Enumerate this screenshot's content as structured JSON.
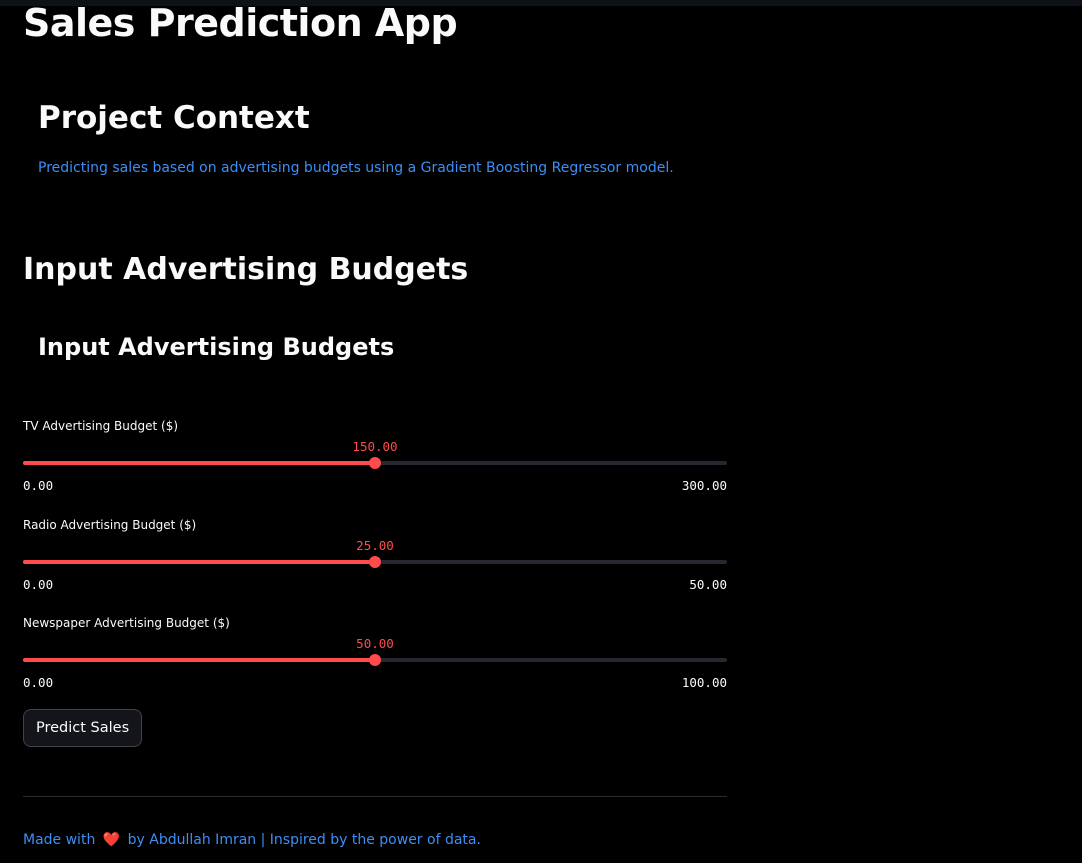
{
  "app": {
    "title": "Sales Prediction App"
  },
  "context": {
    "heading": "Project Context",
    "text": "Predicting sales based on advertising budgets using a Gradient Boosting Regressor model."
  },
  "inputs": {
    "heading": "Input Advertising Budgets",
    "subheading": "Input Advertising Budgets",
    "sliders": [
      {
        "label": "TV Advertising Budget ($)",
        "value": "150.00",
        "min": "0.00",
        "max": "300.00",
        "fraction": 0.5
      },
      {
        "label": "Radio Advertising Budget ($)",
        "value": "25.00",
        "min": "0.00",
        "max": "50.00",
        "fraction": 0.5
      },
      {
        "label": "Newspaper Advertising Budget ($)",
        "value": "50.00",
        "min": "0.00",
        "max": "100.00",
        "fraction": 0.5
      }
    ]
  },
  "actions": {
    "predict_label": "Predict Sales"
  },
  "footer": {
    "prefix": "Made with",
    "heart": "❤️",
    "suffix": "by Abdullah Imran | Inspired by the power of data."
  },
  "colors": {
    "accent": "#ff4b4b",
    "link": "#3d8ef5",
    "background": "#000000"
  }
}
